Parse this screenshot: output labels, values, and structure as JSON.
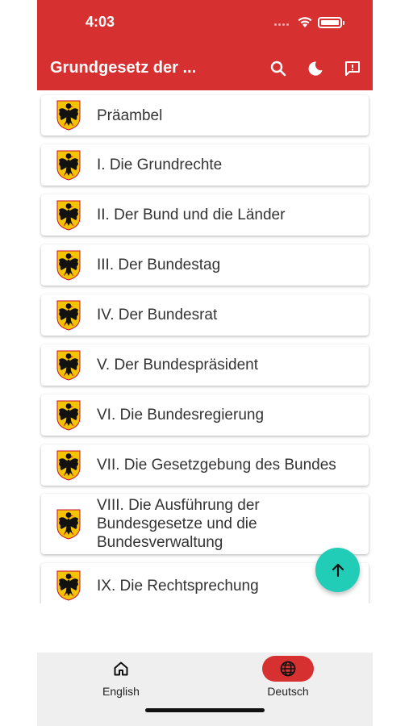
{
  "status_bar": {
    "time": "4:03"
  },
  "app_bar": {
    "title": "Grundgesetz der ...",
    "actions": [
      {
        "icon": "search-icon"
      },
      {
        "icon": "moon-icon"
      },
      {
        "icon": "feedback-icon"
      }
    ]
  },
  "sections": [
    {
      "label": "Präambel",
      "icon": "eagle-coat-of-arms-icon"
    },
    {
      "label": "I. Die Grundrechte",
      "icon": "eagle-coat-of-arms-icon"
    },
    {
      "label": "II. Der Bund und die Länder",
      "icon": "eagle-coat-of-arms-icon"
    },
    {
      "label": "III. Der Bundestag",
      "icon": "eagle-coat-of-arms-icon"
    },
    {
      "label": "IV. Der Bundesrat",
      "icon": "eagle-coat-of-arms-icon"
    },
    {
      "label": "V. Der Bundespräsident",
      "icon": "eagle-coat-of-arms-icon"
    },
    {
      "label": "VI. Die Bundesregierung",
      "icon": "eagle-coat-of-arms-icon"
    },
    {
      "label": "VII. Die Gesetzgebung des Bundes",
      "icon": "eagle-coat-of-arms-icon"
    },
    {
      "label": "VIII. Die Ausführung der Bundesgesetze und die Bundesverwaltung",
      "icon": "eagle-coat-of-arms-icon"
    },
    {
      "label": "IX. Die Rechtsprechung",
      "icon": "eagle-coat-of-arms-icon"
    }
  ],
  "fab": {
    "icon": "arrow-up-icon"
  },
  "bottom_nav": {
    "items": [
      {
        "label": "English",
        "icon": "home-icon",
        "selected": false
      },
      {
        "label": "Deutsch",
        "icon": "globe-icon",
        "selected": true
      }
    ]
  },
  "colors": {
    "primary": "#d63031",
    "accent": "#22cdb8",
    "nav_background": "#efefef"
  }
}
